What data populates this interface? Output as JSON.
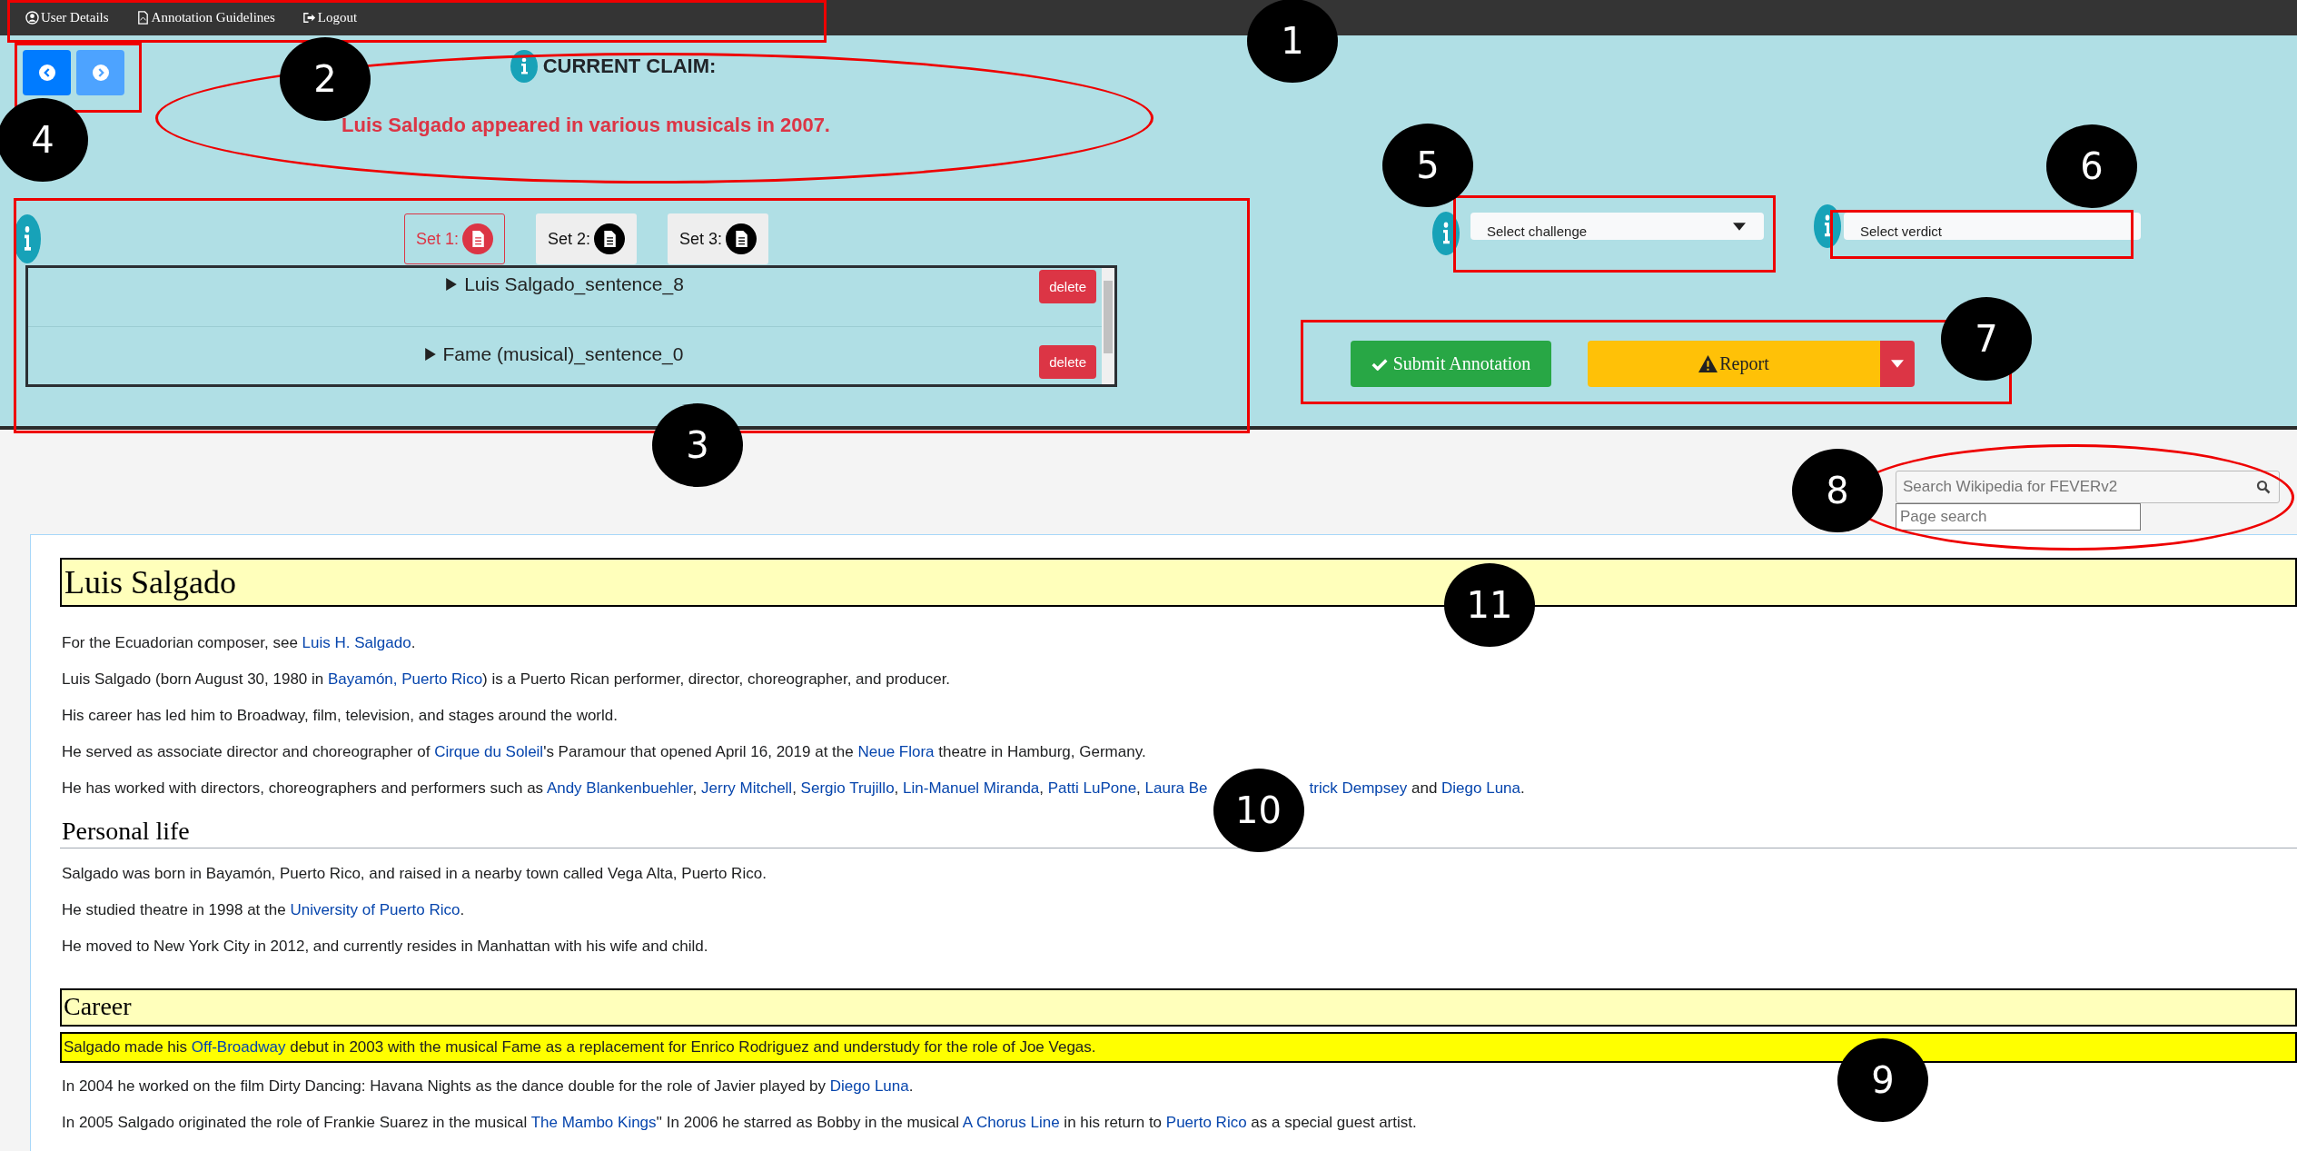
{
  "nav_menu": [
    {
      "label": "User Details"
    },
    {
      "label": "Annotation Guidelines"
    },
    {
      "label": "Logout"
    }
  ],
  "claim": {
    "heading": "CURRENT CLAIM:",
    "text": "Luis Salgado appeared in various musicals in 2007."
  },
  "evidence_sets": [
    {
      "label": "Set 1:",
      "selected": true
    },
    {
      "label": "Set 2:",
      "selected": false
    },
    {
      "label": "Set 3:",
      "selected": false
    }
  ],
  "evidence_sentences": [
    {
      "label": "Luis Salgado_sentence_8",
      "action": "delete"
    },
    {
      "label": "Fame (musical)_sentence_0",
      "action": "delete"
    }
  ],
  "challenge_select": {
    "placeholder": "Select challenge"
  },
  "verdict_select": {
    "placeholder": "Select verdict"
  },
  "submit_button": "Submit Annotation",
  "report_button": "Report",
  "search": {
    "placeholder": "Search Wikipedia for FEVERv2"
  },
  "page_search": {
    "placeholder": "Page search"
  },
  "article": {
    "title": "Luis Salgado",
    "blocks": [
      {
        "kind": "paragraph",
        "highlighted": false,
        "segments": [
          {
            "kind": "text",
            "text": "For the Ecuadorian composer, see "
          },
          {
            "kind": "link",
            "text": "Luis H. Salgado"
          },
          {
            "kind": "text",
            "text": "."
          }
        ]
      },
      {
        "kind": "paragraph",
        "highlighted": false,
        "segments": [
          {
            "kind": "text",
            "text": "Luis Salgado (born August 30, 1980 in "
          },
          {
            "kind": "link",
            "text": "Bayamón, Puerto Rico"
          },
          {
            "kind": "text",
            "text": ") is a Puerto Rican performer, director, choreographer, and producer."
          }
        ]
      },
      {
        "kind": "paragraph",
        "highlighted": false,
        "segments": [
          {
            "kind": "text",
            "text": "His career has led him to Broadway, film, television, and stages around the world."
          }
        ]
      },
      {
        "kind": "paragraph",
        "highlighted": false,
        "segments": [
          {
            "kind": "text",
            "text": "He served as associate director and choreographer of "
          },
          {
            "kind": "link",
            "text": "Cirque du Soleil"
          },
          {
            "kind": "text",
            "text": "'s Paramour that opened April 16, 2019 at the "
          },
          {
            "kind": "link",
            "text": "Neue Flora"
          },
          {
            "kind": "text",
            "text": " theatre in Hamburg, Germany."
          }
        ]
      },
      {
        "kind": "paragraph",
        "highlighted": false,
        "segments": [
          {
            "kind": "text",
            "text": "He has worked with directors, choreographers and performers such as "
          },
          {
            "kind": "link",
            "text": "Andy Blankenbuehler"
          },
          {
            "kind": "text",
            "text": ", "
          },
          {
            "kind": "link",
            "text": "Jerry Mitchell"
          },
          {
            "kind": "text",
            "text": ", "
          },
          {
            "kind": "link",
            "text": "Sergio Trujillo"
          },
          {
            "kind": "text",
            "text": ", "
          },
          {
            "kind": "link",
            "text": "Lin-Manuel Miranda"
          },
          {
            "kind": "text",
            "text": ", "
          },
          {
            "kind": "link",
            "text": "Patti LuPone"
          },
          {
            "kind": "text",
            "text": ", "
          },
          {
            "kind": "link",
            "text": "Laura Be"
          },
          {
            "kind": "callout",
            "text": "10"
          },
          {
            "kind": "link",
            "text": "trick Dempsey"
          },
          {
            "kind": "text",
            "text": " and "
          },
          {
            "kind": "link",
            "text": "Diego Luna"
          },
          {
            "kind": "text",
            "text": "."
          }
        ]
      },
      {
        "kind": "section_heading",
        "highlighted": false,
        "text": "Personal life"
      },
      {
        "kind": "paragraph",
        "highlighted": false,
        "segments": [
          {
            "kind": "text",
            "text": "Salgado was born in Bayamón, Puerto Rico, and raised in a nearby town called Vega Alta, Puerto Rico."
          }
        ]
      },
      {
        "kind": "paragraph",
        "highlighted": false,
        "segments": [
          {
            "kind": "text",
            "text": "He studied theatre in 1998 at the "
          },
          {
            "kind": "link",
            "text": "University of Puerto Rico"
          },
          {
            "kind": "text",
            "text": "."
          }
        ]
      },
      {
        "kind": "paragraph",
        "highlighted": false,
        "segments": [
          {
            "kind": "text",
            "text": "He moved to New York City in 2012, and currently resides in Manhattan with his wife and child."
          }
        ]
      },
      {
        "kind": "section_heading",
        "highlighted": true,
        "text": "Career"
      },
      {
        "kind": "paragraph",
        "highlighted": true,
        "segments": [
          {
            "kind": "text",
            "text": "Salgado made his "
          },
          {
            "kind": "link",
            "text": "Off-Broadway"
          },
          {
            "kind": "text",
            "text": " debut in 2003 with the musical Fame as a replacement for Enrico Rodriguez and understudy for the role of Joe Vegas."
          }
        ]
      },
      {
        "kind": "paragraph",
        "highlighted": false,
        "segments": [
          {
            "kind": "text",
            "text": "In 2004 he worked on the film Dirty Dancing: Havana Nights as the dance double for the role of Javier played by "
          },
          {
            "kind": "link",
            "text": "Diego Luna"
          },
          {
            "kind": "text",
            "text": "."
          }
        ]
      },
      {
        "kind": "paragraph",
        "highlighted": false,
        "segments": [
          {
            "kind": "text",
            "text": "In 2005 Salgado originated the role of Frankie Suarez in the musical "
          },
          {
            "kind": "link",
            "text": "The Mambo Kings"
          },
          {
            "kind": "text",
            "text": "'' In 2006 he starred as Bobby in the musical "
          },
          {
            "kind": "link",
            "text": "A Chorus Line"
          },
          {
            "kind": "text",
            "text": " in his return to "
          },
          {
            "kind": "link",
            "text": "Puerto Rico"
          },
          {
            "kind": "text",
            "text": " as a special guest artist."
          }
        ]
      }
    ]
  },
  "callouts": [
    {
      "number": "1"
    },
    {
      "number": "2"
    },
    {
      "number": "3"
    },
    {
      "number": "4"
    },
    {
      "number": "5"
    },
    {
      "number": "6"
    },
    {
      "number": "7"
    },
    {
      "number": "8"
    },
    {
      "number": "9"
    },
    {
      "number": "11"
    }
  ]
}
